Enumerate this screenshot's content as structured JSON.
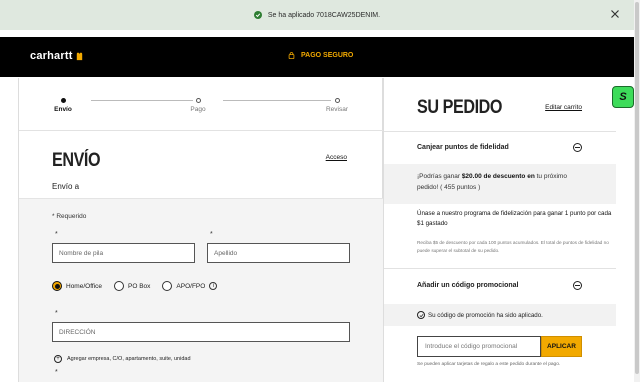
{
  "notification": {
    "message": "Se ha aplicado 7018CAW25DENIM."
  },
  "header": {
    "logo_text": "carhartt",
    "secure_label": "PAGO SEGURO"
  },
  "steps": [
    {
      "label": "Envío",
      "active": true
    },
    {
      "label": "Pago",
      "active": false
    },
    {
      "label": "Revisar",
      "active": false
    }
  ],
  "shipping": {
    "title": "ENVÍO",
    "access_link": "Acceso",
    "ship_to_label": "Envío a",
    "required_note": "* Requerido",
    "first_name_placeholder": "Nombre de pila",
    "last_name_placeholder": "Apellido",
    "address_types": [
      "Home/Office",
      "PO Box",
      "APO/FPO"
    ],
    "selected_address_type": "Home/Office",
    "info_icon_text": "i",
    "address_placeholder": "DIRECCIÓN",
    "add_line_label": "Agregar empresa, C/O, apartamento, suite, unidad",
    "required_marker": "*"
  },
  "summary": {
    "title": "SU PEDIDO",
    "edit_cart": "Editar carrito",
    "loyalty_title": "Canjear puntos de fidelidad",
    "loyalty_prefix": "¡Podrías ganar ",
    "loyalty_amount": "$20.00 de descuento en",
    "loyalty_suffix": " tu próximo pedido! ( 455 puntos )",
    "join_text": "Únase a nuestro programa de fidelización para ganar 1 punto por cada $1 gastado",
    "small_print": "Reciba $5 de descuento por cada 100 puntos acumulados. El total de puntos de fidelidad no puede superar el subtotal de su pedido.",
    "promo_title": "Añadir un código promocional",
    "promo_applied": "Su código de promoción ha sido aplicado.",
    "promo_placeholder": "Introduce el código promocional",
    "apply_button": "APLICAR",
    "gift_note": "Se pueden aplicar tarjetas de regalo a este pedido durante el pago."
  },
  "floating_badge": "S",
  "colors": {
    "accent": "#f2a900",
    "header_bg": "#000000",
    "banner_bg": "#dfe8df",
    "success": "#2e7d32",
    "badge_green": "#3ddc5a"
  }
}
